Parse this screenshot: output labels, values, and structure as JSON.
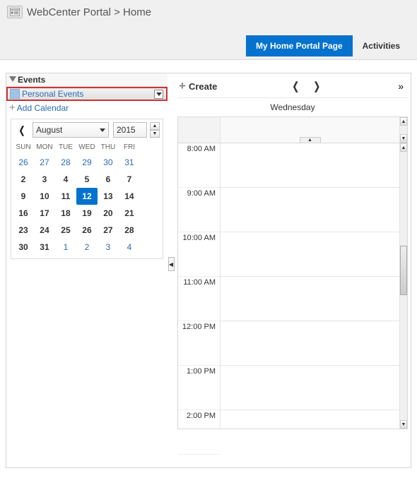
{
  "header": {
    "breadcrumb": "WebCenter Portal > Home",
    "tabs": [
      "My Home Portal Page",
      "Activities"
    ],
    "active_tab_index": 0
  },
  "events_panel": {
    "title": "Events",
    "calendars": [
      {
        "name": "Personal Events",
        "color": "#9ec3e6"
      }
    ],
    "add_calendar_label": "Add Calendar"
  },
  "month_picker": {
    "month": "August",
    "year": "2015",
    "days_of_week": [
      "SUN",
      "MON",
      "TUE",
      "WED",
      "THU",
      "FRI"
    ],
    "weeks": [
      [
        {
          "d": "26",
          "other": true
        },
        {
          "d": "27",
          "other": true
        },
        {
          "d": "28",
          "other": true
        },
        {
          "d": "29",
          "other": true
        },
        {
          "d": "30",
          "other": true
        },
        {
          "d": "31",
          "other": true
        }
      ],
      [
        {
          "d": "2"
        },
        {
          "d": "3"
        },
        {
          "d": "4"
        },
        {
          "d": "5"
        },
        {
          "d": "6"
        },
        {
          "d": "7"
        }
      ],
      [
        {
          "d": "9"
        },
        {
          "d": "10"
        },
        {
          "d": "11"
        },
        {
          "d": "12",
          "today": true
        },
        {
          "d": "13"
        },
        {
          "d": "14"
        }
      ],
      [
        {
          "d": "16"
        },
        {
          "d": "17"
        },
        {
          "d": "18"
        },
        {
          "d": "19"
        },
        {
          "d": "20"
        },
        {
          "d": "21"
        }
      ],
      [
        {
          "d": "23"
        },
        {
          "d": "24"
        },
        {
          "d": "25"
        },
        {
          "d": "26"
        },
        {
          "d": "27"
        },
        {
          "d": "28"
        }
      ],
      [
        {
          "d": "30"
        },
        {
          "d": "31"
        },
        {
          "d": "1",
          "other": true
        },
        {
          "d": "2",
          "other": true
        },
        {
          "d": "3",
          "other": true
        },
        {
          "d": "4",
          "other": true
        }
      ]
    ]
  },
  "day_view": {
    "create_label": "Create",
    "day_label": "Wednesday",
    "hours": [
      "8:00 AM",
      "9:00 AM",
      "10:00 AM",
      "11:00 AM",
      "12:00 PM",
      "1:00 PM",
      "2:00 PM"
    ]
  }
}
